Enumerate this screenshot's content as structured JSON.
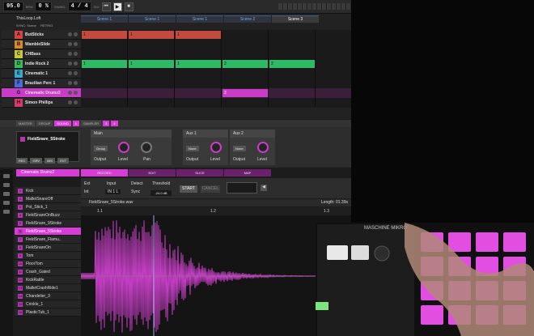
{
  "transport": {
    "tempo": "95.0",
    "bpm_label": "BPM",
    "swing": "0 %",
    "swing_label": "SWING",
    "signature": "4 / 4",
    "signature_label": "SIG"
  },
  "project": {
    "title": "ThisLoop.Loft",
    "sync_label": "SYNC: Scene",
    "retrig_label": "RETRIG"
  },
  "scenes": [
    "Scene 1",
    "Scene 1",
    "Scene 1",
    "Scene 2",
    "Scene 3"
  ],
  "groups": [
    {
      "letter": "A",
      "name": "ButSticks",
      "color": "#d64545"
    },
    {
      "letter": "B",
      "name": "WambleSlide",
      "color": "#d68a2e"
    },
    {
      "letter": "C",
      "name": "CHBass",
      "color": "#c7c83a"
    },
    {
      "letter": "D",
      "name": "Indie Rock 2",
      "color": "#3ab85a"
    },
    {
      "letter": "E",
      "name": "Cinematic 1",
      "color": "#3aa8c8"
    },
    {
      "letter": "F",
      "name": "Brazilian Perc 1",
      "color": "#4a6ad6"
    },
    {
      "letter": "G",
      "name": "Cinematic Drumz2",
      "color": "#c83cc8"
    },
    {
      "letter": "H",
      "name": "Simon Phillips",
      "color": "#d63a6a"
    }
  ],
  "clips": {
    "row_a": [
      "1",
      "1",
      "1"
    ],
    "row_d": [
      "1",
      "1",
      "1",
      "2",
      "2"
    ],
    "row_g": [
      "2"
    ]
  },
  "mid_tabs": [
    "MASTER",
    "GROUP",
    "SOUND",
    "1",
    "SAMPLER",
    "3",
    "4"
  ],
  "plugin": {
    "sample_name": "FieldSnare_5Stroke",
    "main_title": "Main",
    "aux1_title": "Aux 1",
    "aux2_title": "Aux 2",
    "output_sel": "Group",
    "aux1_sel": "None",
    "aux2_sel": "None",
    "labels": {
      "output": "Output",
      "level": "Level",
      "pan": "Pan"
    },
    "bottom_buttons": [
      "REC",
      "GRV",
      "MIX",
      "EXT"
    ]
  },
  "pad_panel": {
    "group_name": "Cinematic Drumz2",
    "tabs": [
      "RECORD",
      "EDIT",
      "SLICE",
      "MAP"
    ],
    "pads": [
      {
        "n": "1",
        "name": "Kick"
      },
      {
        "n": "2",
        "name": "MalletSnareOff"
      },
      {
        "n": "3",
        "name": "Pot_Stick_1"
      },
      {
        "n": "4",
        "name": "FieldSnareOnBuzz"
      },
      {
        "n": "5",
        "name": "FieldSnare_9Stroke"
      },
      {
        "n": "6",
        "name": "FieldSnare_5Stroke"
      },
      {
        "n": "7",
        "name": "FieldSnare_Flamu.."
      },
      {
        "n": "8",
        "name": "FieldSnareOn"
      },
      {
        "n": "9",
        "name": "Tom"
      },
      {
        "n": "10",
        "name": "FloorTom"
      },
      {
        "n": "11",
        "name": "Crash_Gated"
      },
      {
        "n": "12",
        "name": "KickRattle"
      },
      {
        "n": "13",
        "name": "MalletCrashRide1"
      },
      {
        "n": "14",
        "name": "Chandelier_3"
      },
      {
        "n": "15",
        "name": "Crinkle_1"
      },
      {
        "n": "16",
        "name": "PlasticTub_1"
      }
    ],
    "selected_index": 5
  },
  "record": {
    "ext": "Ext",
    "int": "Int",
    "input_label": "Input",
    "input_value": "IN 1 L",
    "detect": "Detect",
    "sync": "Sync",
    "threshold_label": "Threshold",
    "threshold_value": "-24.0 dB",
    "start": "START",
    "cancel": "CANCEL"
  },
  "waveform": {
    "file": "FieldSnare_5Stroke.wav",
    "length": "Length: 01.39s",
    "ruler": [
      "1.1",
      "1.2",
      "1.3"
    ]
  },
  "overlay_text": {
    "brand": "MASCHINE MIKRO"
  },
  "colors": {
    "accent": "#d63cd6",
    "group_selected": "#c83cc8"
  }
}
